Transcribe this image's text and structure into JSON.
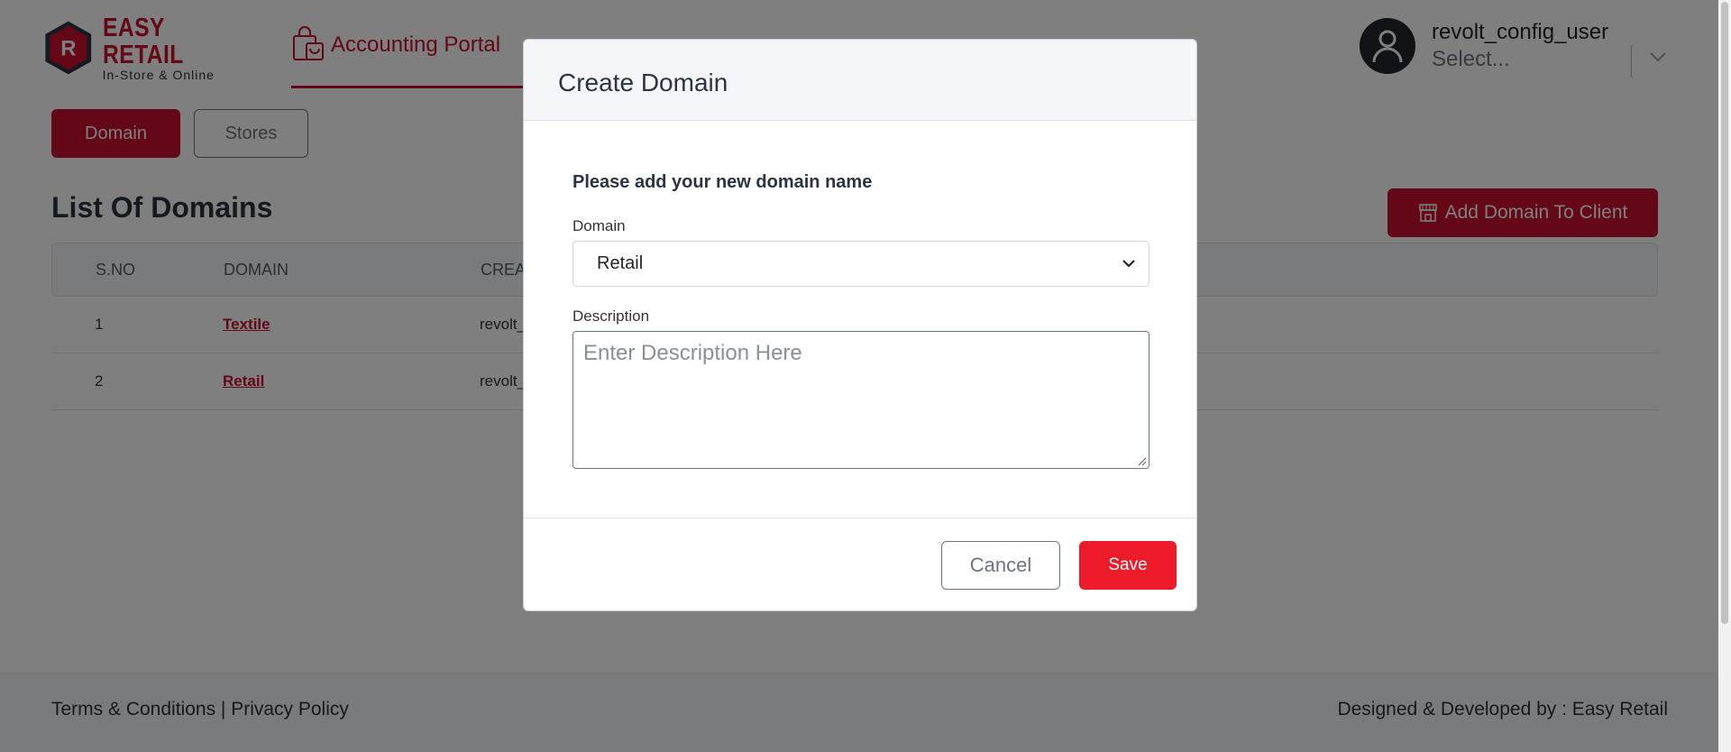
{
  "brand": {
    "name": "EASY RETAIL",
    "tagline": "In-Store & Online",
    "logo_letter": "R",
    "color": "#c8102e"
  },
  "nav": {
    "portal_label": "Accounting Portal",
    "portal_icon": "shopping-bag-icon"
  },
  "user": {
    "name": "revolt_config_user",
    "select_placeholder": "Select..."
  },
  "tabs": {
    "domain": "Domain",
    "stores": "Stores"
  },
  "list": {
    "title": "List Of Domains",
    "add_button": "Add Domain To Client",
    "add_icon": "store-icon",
    "columns": [
      "S.NO",
      "DOMAIN",
      "CREA"
    ],
    "rows": [
      {
        "sno": "1",
        "domain": "Textile",
        "created": "revolt_"
      },
      {
        "sno": "2",
        "domain": "Retail",
        "created": "revolt_"
      }
    ]
  },
  "footer": {
    "left": "Terms & Conditions | Privacy Policy",
    "right": "Designed & Developed by : Easy Retail"
  },
  "modal": {
    "title": "Create Domain",
    "intro": "Please add your new domain name",
    "domain_label": "Domain",
    "domain_value": "Retail",
    "description_label": "Description",
    "description_placeholder": "Enter Description Here",
    "cancel_label": "Cancel",
    "save_label": "Save",
    "save_color": "#ee1c2b"
  }
}
